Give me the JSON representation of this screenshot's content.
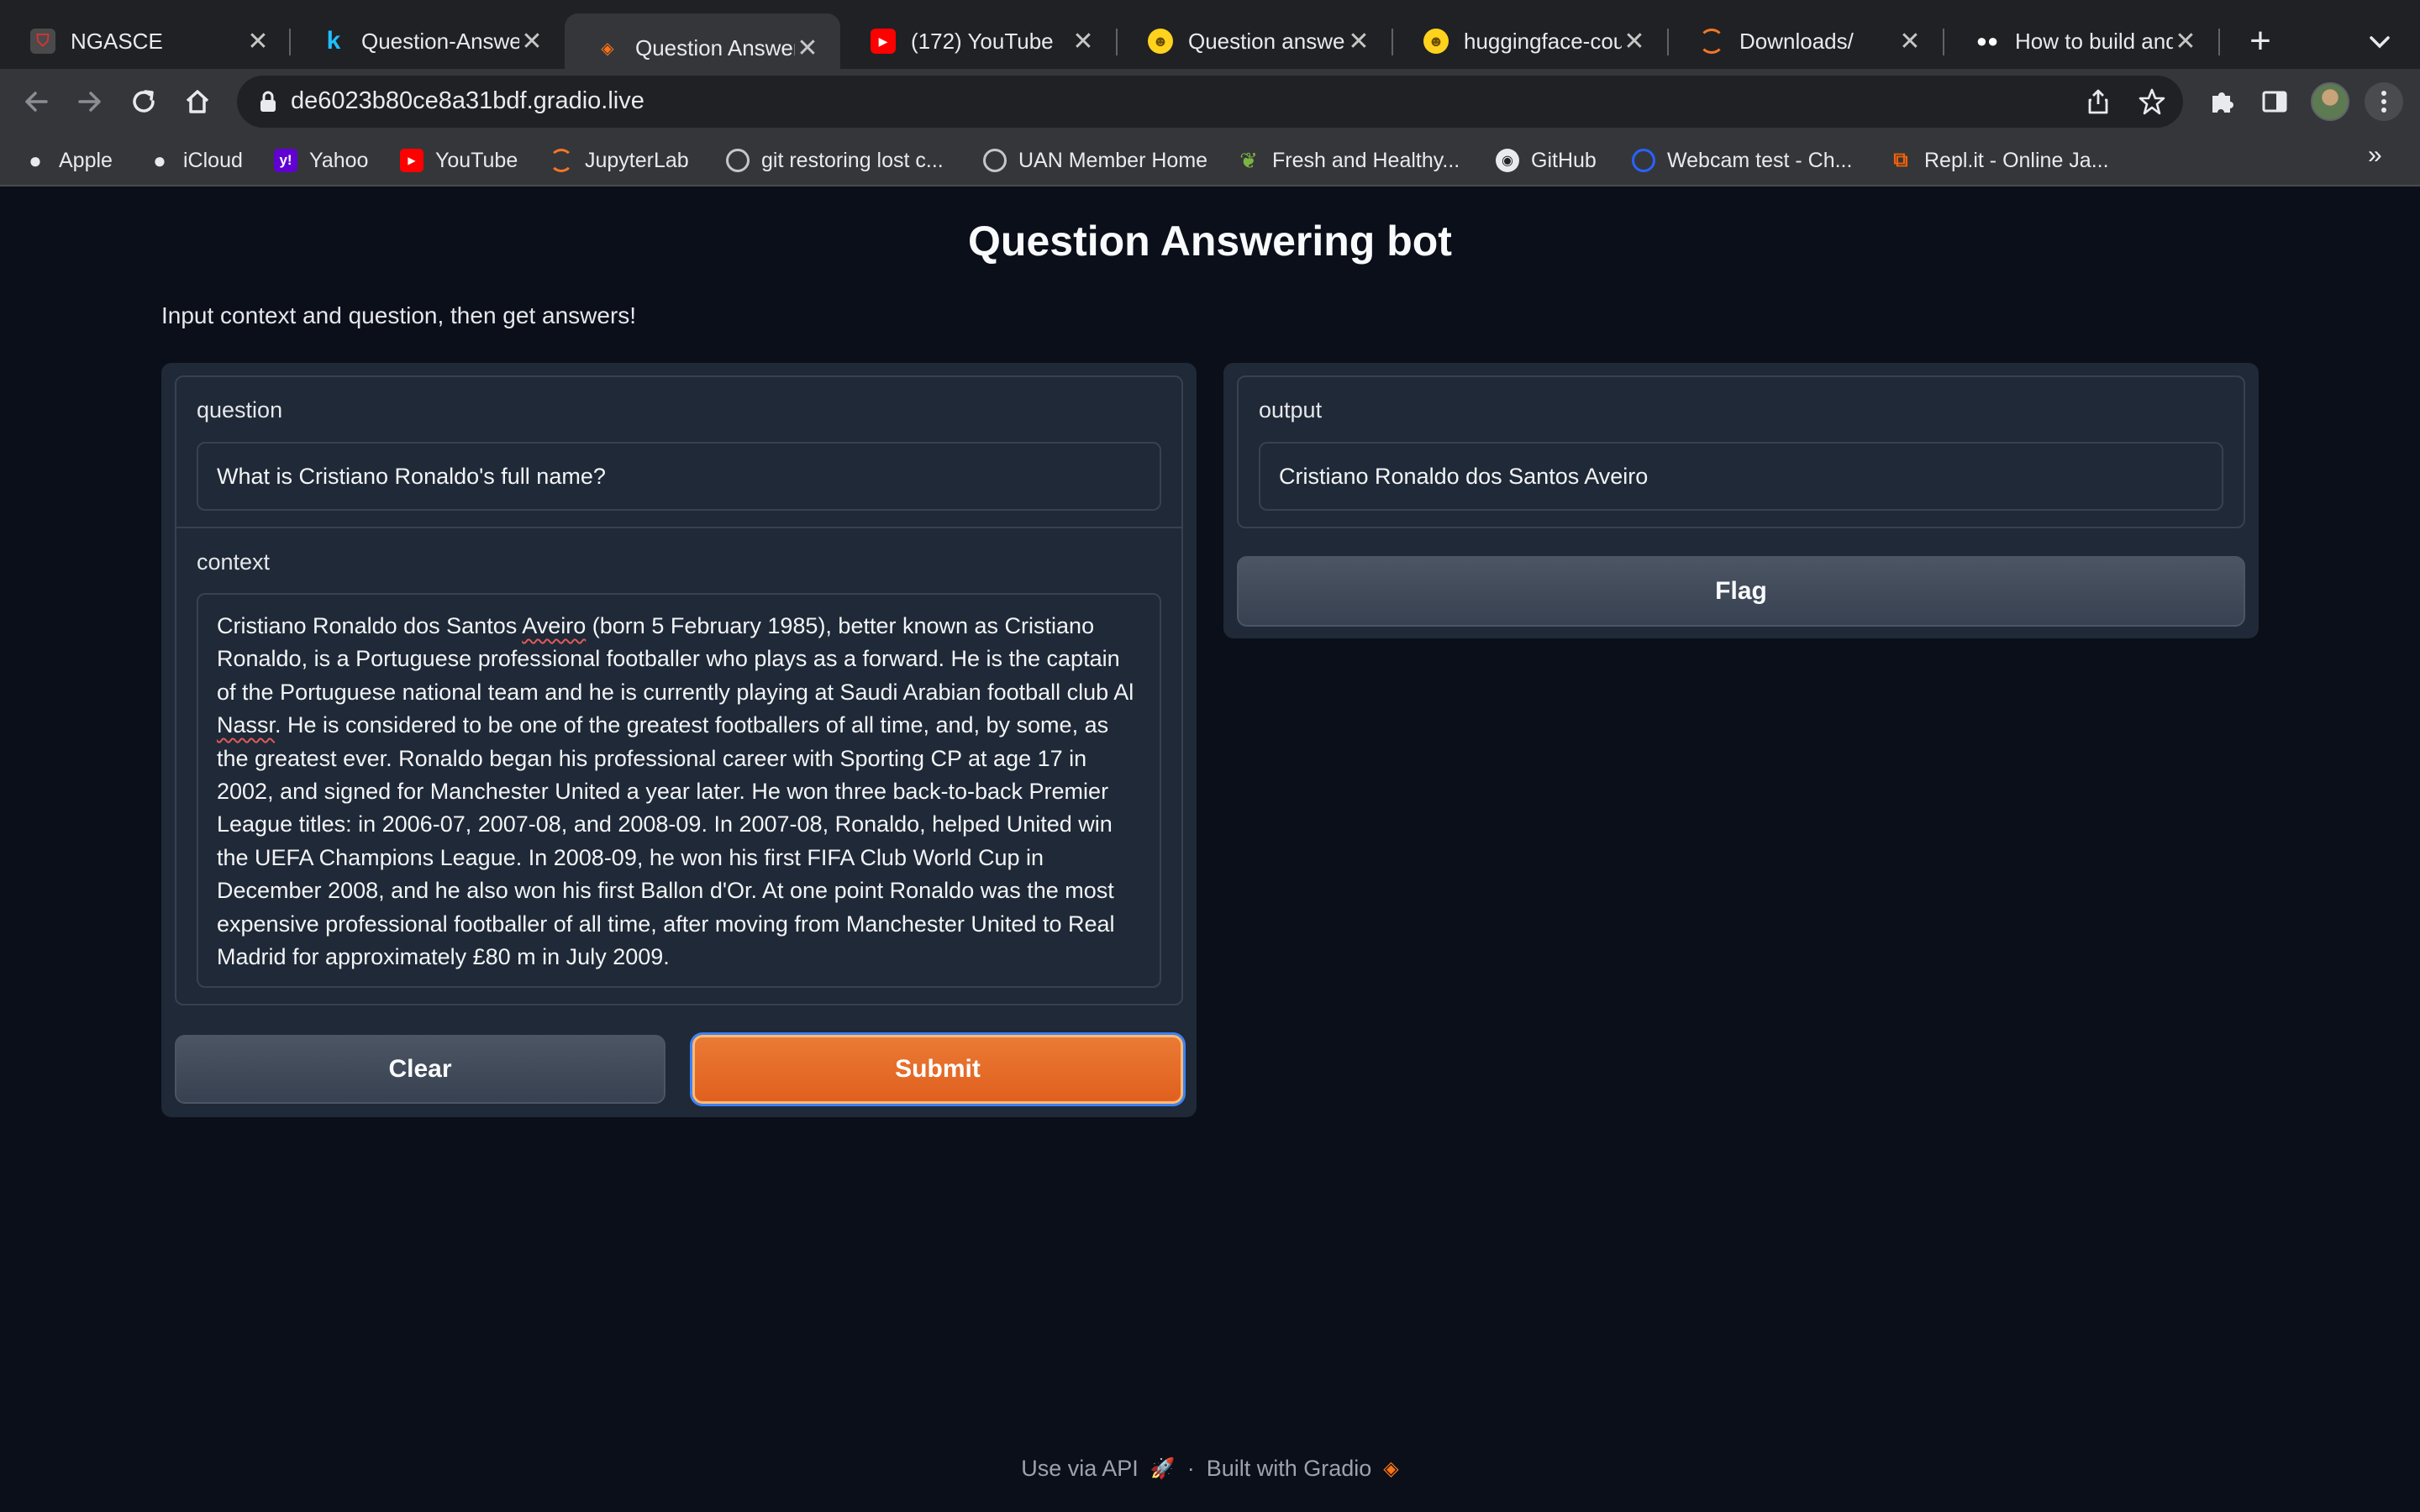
{
  "browser": {
    "tabs": [
      {
        "title": "NGASCE",
        "icon": "ngasce-shield-icon",
        "active": false
      },
      {
        "title": "Question-Answer",
        "icon": "kaggle-k-icon",
        "active": false
      },
      {
        "title": "Question Answeri",
        "icon": "gradio-icon",
        "active": true
      },
      {
        "title": "(172) YouTube",
        "icon": "youtube-icon",
        "active": false
      },
      {
        "title": "Question answerir",
        "icon": "huggingface-icon",
        "active": false
      },
      {
        "title": "huggingface-cour",
        "icon": "huggingface-icon",
        "active": false
      },
      {
        "title": "Downloads/",
        "icon": "jupyter-icon",
        "active": false
      },
      {
        "title": "How to build and",
        "icon": "medium-icon",
        "active": false
      }
    ],
    "url": "de6023b80ce8a31bdf.gradio.live",
    "bookmarks": [
      {
        "label": "Apple",
        "icon": "apple-icon"
      },
      {
        "label": "iCloud",
        "icon": "apple-icon"
      },
      {
        "label": "Yahoo",
        "icon": "yahoo-icon"
      },
      {
        "label": "YouTube",
        "icon": "youtube-icon"
      },
      {
        "label": "JupyterLab",
        "icon": "jupyter-icon"
      },
      {
        "label": "git restoring lost c...",
        "icon": "globe-icon"
      },
      {
        "label": "UAN Member Home",
        "icon": "globe-icon"
      },
      {
        "label": "Fresh and Healthy...",
        "icon": "leaf-icon"
      },
      {
        "label": "GitHub",
        "icon": "github-icon"
      },
      {
        "label": "Webcam test - Ch...",
        "icon": "webcam-icon"
      },
      {
        "label": "Repl.it - Online Ja...",
        "icon": "replit-icon"
      }
    ],
    "bookmarks_overflow": "»"
  },
  "app": {
    "title": "Question Answering bot",
    "description": "Input context and question, then get answers!",
    "inputs": {
      "question_label": "question",
      "question_value": "What is Cristiano Ronaldo's full name?",
      "context_label": "context",
      "context_value_parts": [
        "Cristiano Ronaldo dos Santos ",
        "Aveiro",
        " (born 5 February 1985), better known as Cristiano Ronaldo, is a Portuguese professional footballer who plays as a forward. He is the captain of the Portuguese national team and he is currently playing at Saudi Arabian football club Al ",
        "Nassr",
        ". He is considered to be one of the greatest footballers of all time, and, by some, as the greatest ever. Ronaldo began his professional career with Sporting CP at age 17 in 2002, and signed for Manchester United a year later. He won three back-to-back Premier League titles: in 2006-07, 2007-08, and 2008-09. In 2007-08, Ronaldo, helped United win the UEFA Champions League. In 2008-09, he won his first FIFA Club World Cup in December 2008, and he also won his first Ballon d'Or. At one point Ronaldo was the most expensive professional footballer of all time, after moving from Manchester United to Real Madrid for approximately £80 m in July 2009."
      ]
    },
    "buttons": {
      "clear": "Clear",
      "submit": "Submit",
      "flag": "Flag"
    },
    "output": {
      "label": "output",
      "value": "Cristiano Ronaldo dos Santos Aveiro"
    },
    "footer": {
      "api": "Use via API",
      "separator": "·",
      "built_with": "Built with Gradio"
    }
  },
  "colors": {
    "page_bg": "#0b0f19",
    "panel_bg": "#1f2937",
    "border": "#374151",
    "primary": "#e0601e",
    "secondary": "#4b5563"
  }
}
